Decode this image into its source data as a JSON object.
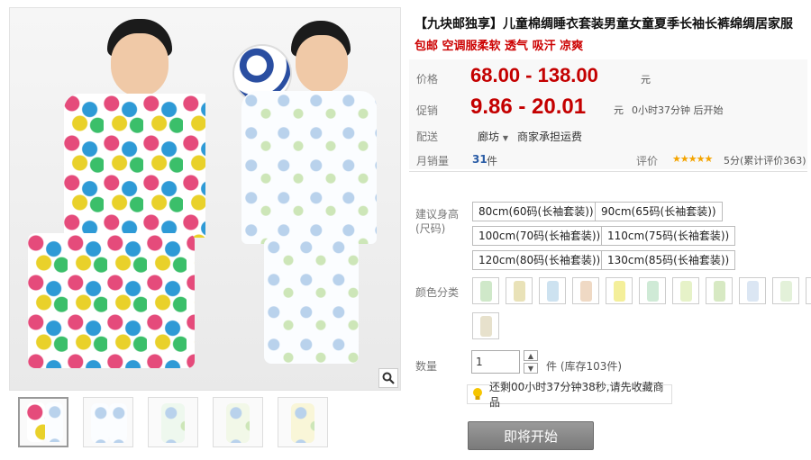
{
  "product": {
    "title": "【九块邮独享】儿童棉绸睡衣套装男童女童夏季长袖长裤绵绸居家服",
    "subtitle": "包邮 空调服柔软 透气 吸汗 凉爽"
  },
  "pricing": {
    "price_label": "价格",
    "price_range": "68.00 - 138.00",
    "price_unit": "元",
    "promo_label": "促销",
    "promo_range": "9.86 - 20.01",
    "promo_unit": "元",
    "promo_countdown": "0小时37分钟 后开始"
  },
  "shipping": {
    "label": "配送",
    "location": "廊坊",
    "dropdown_icon": "chevron-down-icon",
    "shipping_text": "商家承担运费"
  },
  "sales": {
    "label": "月销量",
    "count": "31",
    "count_unit": "件",
    "rating_label": "评价",
    "stars": "★★★★★",
    "rating_text": "5分(累计评价363)"
  },
  "sizes": {
    "label": "建议身高(尺码)",
    "options": [
      "80cm(60码(长袖套装))",
      "90cm(65码(长袖套装))",
      "100cm(70码(长袖套装))",
      "110cm(75码(长袖套装))",
      "120cm(80码(长袖套装))",
      "130cm(85码(长袖套装))"
    ]
  },
  "colors": {
    "label": "颜色分类",
    "swatches": [
      "#cfe8c9",
      "#e9e2b8",
      "#cde2f0",
      "#efd9c4",
      "#f4ef9a",
      "#cfead6",
      "#e6f2c8",
      "#d7e9c3",
      "#dbe6f3",
      "#e3f1d9",
      "#cde8d8",
      "#e7e1cc"
    ]
  },
  "quantity": {
    "label": "数量",
    "value": "1",
    "unit_stock": "件  (库存103件)"
  },
  "notice": {
    "icon": "lightbulb-icon",
    "text": "还剩00小时37分钟38秒,请先收藏商品"
  },
  "action": {
    "start_button": "即将开始"
  },
  "gallery": {
    "zoom_icon": "magnifier-icon",
    "thumbnail_count": 5
  },
  "colors_theme": {
    "price_red": "#c40000",
    "subtitle_red": "#cc0000",
    "button_gray": "#8a8a8a"
  }
}
